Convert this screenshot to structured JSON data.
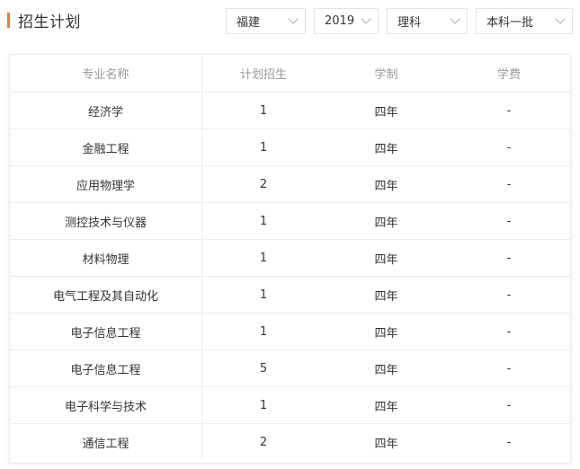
{
  "header": {
    "title": "招生计划"
  },
  "filters": {
    "province": "福建",
    "year": "2019",
    "subject": "理科",
    "batch": "本科一批"
  },
  "table": {
    "columns": [
      "专业名称",
      "计划招生",
      "学制",
      "学费"
    ],
    "rows": [
      {
        "major": "经济学",
        "plan": "1",
        "duration": "四年",
        "fee": "-"
      },
      {
        "major": "金融工程",
        "plan": "1",
        "duration": "四年",
        "fee": "-"
      },
      {
        "major": "应用物理学",
        "plan": "2",
        "duration": "四年",
        "fee": "-"
      },
      {
        "major": "测控技术与仪器",
        "plan": "1",
        "duration": "四年",
        "fee": "-"
      },
      {
        "major": "材料物理",
        "plan": "1",
        "duration": "四年",
        "fee": "-"
      },
      {
        "major": "电气工程及其自动化",
        "plan": "1",
        "duration": "四年",
        "fee": "-"
      },
      {
        "major": "电子信息工程",
        "plan": "1",
        "duration": "四年",
        "fee": "-"
      },
      {
        "major": "电子信息工程",
        "plan": "5",
        "duration": "四年",
        "fee": "-"
      },
      {
        "major": "电子科学与技术",
        "plan": "1",
        "duration": "四年",
        "fee": "-"
      },
      {
        "major": "通信工程",
        "plan": "2",
        "duration": "四年",
        "fee": "-"
      }
    ]
  },
  "colors": {
    "accent": "#f07c1f",
    "header_text": "#999999",
    "body_text": "#333333",
    "border": "#ececec"
  }
}
